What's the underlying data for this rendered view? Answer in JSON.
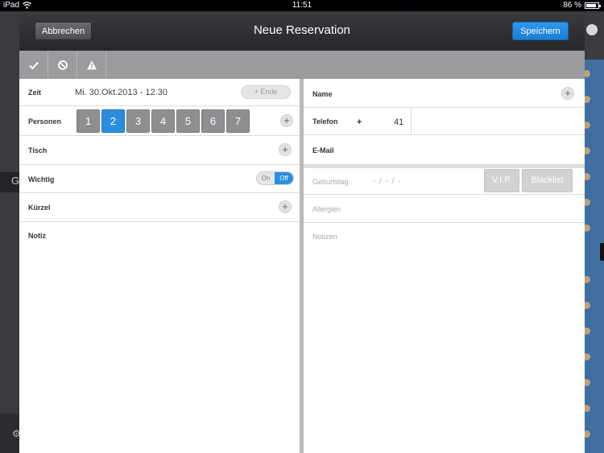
{
  "statusbar": {
    "device": "iPad",
    "time": "11:51",
    "battery": "86 %",
    "battery_level": 0.86
  },
  "background": {
    "left_letter": "G"
  },
  "modal": {
    "title": "Neue Reservation",
    "cancel_label": "Abbrechen",
    "save_label": "Speichern",
    "toolbar": [
      "confirm-icon",
      "cancel-icon",
      "warning-icon"
    ]
  },
  "left": {
    "zeit": {
      "label": "Zeit",
      "value": "Mi. 30.Okt.2013 - 12.30",
      "ende_label": "+ Ende"
    },
    "personen": {
      "label": "Personen",
      "options": [
        "1",
        "2",
        "3",
        "4",
        "5",
        "6",
        "7"
      ],
      "selected": "2"
    },
    "tisch": {
      "label": "Tisch"
    },
    "wichtig": {
      "label": "Wichtig",
      "on_label": "On",
      "off_label": "Off",
      "state": "Off"
    },
    "kuerzel": {
      "label": "Kürzel"
    },
    "notiz": {
      "label": "Notiz"
    }
  },
  "right": {
    "name": {
      "label": "Name"
    },
    "telefon": {
      "label": "Telefon",
      "plus": "+",
      "code": "41"
    },
    "email": {
      "label": "E-Mail"
    },
    "geburtstag": {
      "label": "Geburtstag",
      "value": "- / - / -"
    },
    "vip_label": "V.I.P.",
    "blacklist_label": "Blacklist",
    "allergien": {
      "label": "Allergien"
    },
    "notizen": {
      "label": "Notizen"
    }
  },
  "colors": {
    "accent": "#2a8ee0",
    "header": "#2e2f32",
    "toolbar": "#9b9c9d"
  }
}
